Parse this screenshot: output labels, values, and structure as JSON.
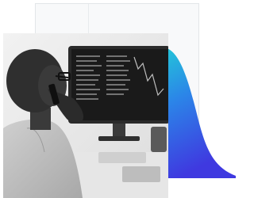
{
  "scene": {
    "description_icon": "photo-image",
    "accent_gradient": [
      "#22d1d6",
      "#2b86e8",
      "#3f39e0"
    ],
    "photo_tint": "#2b2b2b"
  }
}
